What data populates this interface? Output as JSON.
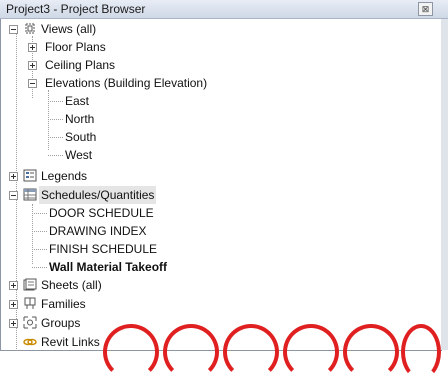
{
  "window": {
    "title": "Project3 - Project Browser",
    "close_glyph": "⊠"
  },
  "tree": {
    "views": "Views (all)",
    "floor_plans": "Floor Plans",
    "ceiling_plans": "Ceiling Plans",
    "elevations": "Elevations (Building Elevation)",
    "east": "East",
    "north": "North",
    "south": "South",
    "west": "West",
    "legends": "Legends",
    "schedules": "Schedules/Quantities",
    "door_schedule": "DOOR SCHEDULE",
    "drawing_index": "DRAWING INDEX",
    "finish_schedule": "FINISH SCHEDULE",
    "wall_takeoff": "Wall Material Takeoff",
    "sheets": "Sheets (all)",
    "families": "Families",
    "groups": "Groups",
    "revit_links": "Revit Links"
  },
  "colors": {
    "selection": "#e5e5e5",
    "annotation_red": "#e02020"
  },
  "icons": [
    "views-icon",
    "legends-icon",
    "schedules-icon",
    "sheets-icon",
    "families-icon",
    "groups-icon",
    "revit-links-icon"
  ]
}
